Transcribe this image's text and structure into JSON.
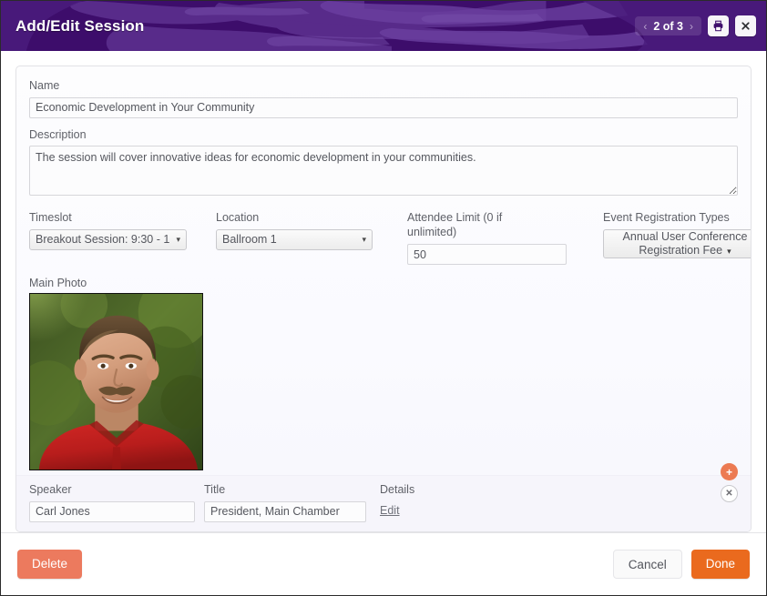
{
  "window": {
    "title": "Add/Edit Session",
    "accent_purple": "#3d0d6b",
    "accent_orange": "#ea6a1e",
    "accent_salmon": "#ec7a5e"
  },
  "header": {
    "pager": {
      "prev_arrow": "‹",
      "label": "2 of 3",
      "next_arrow": "›"
    },
    "print_icon": "print-icon",
    "close_icon": "close-icon"
  },
  "form": {
    "name": {
      "label": "Name",
      "value": "Economic Development in Your Community",
      "placeholder": ""
    },
    "description": {
      "label": "Description",
      "value": "The session will cover innovative ideas for economic development in your communities.",
      "placeholder": ""
    },
    "timeslot": {
      "label": "Timeslot",
      "value": "Breakout Session: 9:30 - 1",
      "caret": "▾"
    },
    "location": {
      "label": "Location",
      "value": "Ballroom 1",
      "caret": "▾"
    },
    "attendee_limit": {
      "label": "Attendee Limit (0 if unlimited)",
      "value": "50",
      "placeholder": ""
    },
    "registration_types": {
      "label": "Event Registration Types",
      "value": "Annual User Conference Registration Fee",
      "value_line1": "Annual User Conference",
      "value_line2": "Registration Fee",
      "caret": "▾"
    },
    "main_photo": {
      "label": "Main Photo",
      "alt": "Portrait photo of a smiling man with a mustache wearing a red polo shirt outdoors"
    },
    "speaker": {
      "label": "Speaker",
      "value": "Carl Jones",
      "placeholder": ""
    },
    "speaker_title": {
      "label": "Title",
      "value": "President, Main Chamber",
      "placeholder": ""
    },
    "details": {
      "label": "Details",
      "edit_link": "Edit"
    },
    "actions": {
      "add_icon": "+",
      "remove_icon": "✕"
    }
  },
  "footer": {
    "delete_label": "Delete",
    "cancel_label": "Cancel",
    "done_label": "Done"
  }
}
